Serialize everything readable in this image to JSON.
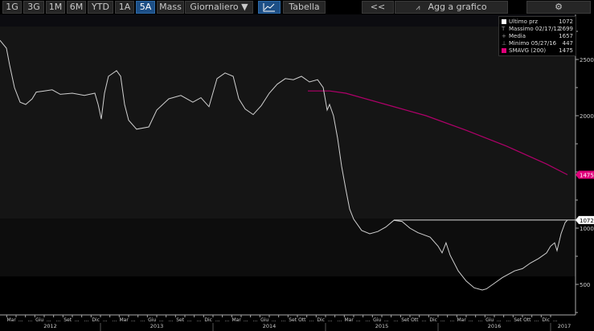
{
  "toolbar": {
    "ranges": [
      "1G",
      "3G",
      "1M",
      "6M",
      "YTD",
      "1A",
      "5A",
      "Mass"
    ],
    "active_range": "5A",
    "frequency": "Giornaliero ▼",
    "chart_icon": "line-chart-icon",
    "table": "Tabella",
    "back": "<<",
    "add_to_chart": "Agg a grafico",
    "settings_icon": "gear-icon"
  },
  "legend": [
    {
      "label": "Ultimo prz",
      "value": "1072",
      "color": "#ffffff",
      "glyph": ""
    },
    {
      "label": "Massimo 02/17/12",
      "value": "2699",
      "glyph": "T"
    },
    {
      "label": "Media",
      "value": "1657",
      "glyph": "+"
    },
    {
      "label": "Minimo 05/27/16",
      "value": "447",
      "glyph": "⊥"
    },
    {
      "label": "SMAVG (200)",
      "value": "1475",
      "color": "#e0007a",
      "glyph": ""
    }
  ],
  "tags": {
    "last": "1072",
    "smavg": "1475"
  },
  "colors": {
    "price": "#d0d0d0",
    "smavg": "#b0006a",
    "tag_smavg": "#e0007a"
  },
  "chart_data": {
    "type": "line",
    "y_ticks": [
      500,
      1000,
      2000,
      2500
    ],
    "ylim": [
      250,
      2850
    ],
    "xlim": [
      2012.107,
      2017.2
    ],
    "years": [
      "2012",
      "2013",
      "2014",
      "2015",
      "2016",
      "2017"
    ],
    "month_labels_from_mar_2012": [
      "Mar",
      "...",
      "...",
      "Giu",
      "...",
      "...",
      "Set",
      "...",
      "...",
      "Dic",
      "...",
      "...",
      "Mar",
      "...",
      "...",
      "Giu",
      "...",
      "...",
      "Set",
      "...",
      "...",
      "Dic",
      "...",
      "...",
      "Mar",
      "...",
      "...",
      "Giu",
      "...",
      "...",
      "Set",
      "Ott",
      "...",
      "Dic",
      "...",
      "...",
      "Mar",
      "...",
      "...",
      "Giu",
      "...",
      "...",
      "Set",
      "Ott",
      "...",
      "Dic",
      "...",
      "...",
      "Mar",
      "...",
      "...",
      "Giu",
      "...",
      "...",
      "Set",
      "Ott",
      "...",
      "Dic",
      "..."
    ],
    "series": [
      {
        "name": "Ultimo prz",
        "points": [
          [
            2012.107,
            2670
          ],
          [
            2012.164,
            2600
          ],
          [
            2012.193,
            2450
          ],
          [
            2012.236,
            2250
          ],
          [
            2012.286,
            2120
          ],
          [
            2012.336,
            2100
          ],
          [
            2012.393,
            2150
          ],
          [
            2012.429,
            2210
          ],
          [
            2012.5,
            2220
          ],
          [
            2012.571,
            2230
          ],
          [
            2012.643,
            2190
          ],
          [
            2012.75,
            2200
          ],
          [
            2012.857,
            2180
          ],
          [
            2012.95,
            2200
          ],
          [
            2012.979,
            2100
          ],
          [
            2013.007,
            1970
          ],
          [
            2013.036,
            2200
          ],
          [
            2013.071,
            2350
          ],
          [
            2013.143,
            2400
          ],
          [
            2013.179,
            2350
          ],
          [
            2013.214,
            2100
          ],
          [
            2013.25,
            1960
          ],
          [
            2013.321,
            1880
          ],
          [
            2013.429,
            1900
          ],
          [
            2013.5,
            2050
          ],
          [
            2013.607,
            2150
          ],
          [
            2013.714,
            2180
          ],
          [
            2013.821,
            2120
          ],
          [
            2013.893,
            2160
          ],
          [
            2013.964,
            2080
          ],
          [
            2014.036,
            2330
          ],
          [
            2014.107,
            2380
          ],
          [
            2014.179,
            2350
          ],
          [
            2014.229,
            2150
          ],
          [
            2014.286,
            2060
          ],
          [
            2014.357,
            2010
          ],
          [
            2014.429,
            2090
          ],
          [
            2014.5,
            2200
          ],
          [
            2014.571,
            2280
          ],
          [
            2014.643,
            2330
          ],
          [
            2014.714,
            2320
          ],
          [
            2014.786,
            2350
          ],
          [
            2014.857,
            2300
          ],
          [
            2014.929,
            2320
          ],
          [
            2014.979,
            2250
          ],
          [
            2015.014,
            2050
          ],
          [
            2015.036,
            2100
          ],
          [
            2015.071,
            2000
          ],
          [
            2015.107,
            1800
          ],
          [
            2015.143,
            1550
          ],
          [
            2015.179,
            1350
          ],
          [
            2015.214,
            1170
          ],
          [
            2015.25,
            1080
          ],
          [
            2015.321,
            980
          ],
          [
            2015.393,
            950
          ],
          [
            2015.464,
            970
          ],
          [
            2015.536,
            1010
          ],
          [
            2015.607,
            1070
          ],
          [
            2015.679,
            1060
          ],
          [
            2015.75,
            1000
          ],
          [
            2015.821,
            960
          ],
          [
            2015.929,
            920
          ],
          [
            2016.0,
            840
          ],
          [
            2016.036,
            780
          ],
          [
            2016.071,
            870
          ],
          [
            2016.107,
            760
          ],
          [
            2016.179,
            620
          ],
          [
            2016.25,
            530
          ],
          [
            2016.321,
            470
          ],
          [
            2016.393,
            450
          ],
          [
            2016.429,
            460
          ],
          [
            2016.5,
            510
          ],
          [
            2016.571,
            560
          ],
          [
            2016.679,
            620
          ],
          [
            2016.75,
            640
          ],
          [
            2016.821,
            690
          ],
          [
            2016.893,
            730
          ],
          [
            2016.964,
            780
          ],
          [
            2017.0,
            840
          ],
          [
            2017.036,
            870
          ],
          [
            2017.057,
            800
          ],
          [
            2017.093,
            950
          ],
          [
            2017.129,
            1050
          ],
          [
            2017.15,
            1072
          ]
        ]
      },
      {
        "name": "SMAVG (200)",
        "points": [
          [
            2014.843,
            2220
          ],
          [
            2015.036,
            2220
          ],
          [
            2015.179,
            2200
          ],
          [
            2015.536,
            2100
          ],
          [
            2015.893,
            2000
          ],
          [
            2016.25,
            1870
          ],
          [
            2016.607,
            1730
          ],
          [
            2016.964,
            1570
          ],
          [
            2017.15,
            1475
          ]
        ]
      }
    ]
  }
}
